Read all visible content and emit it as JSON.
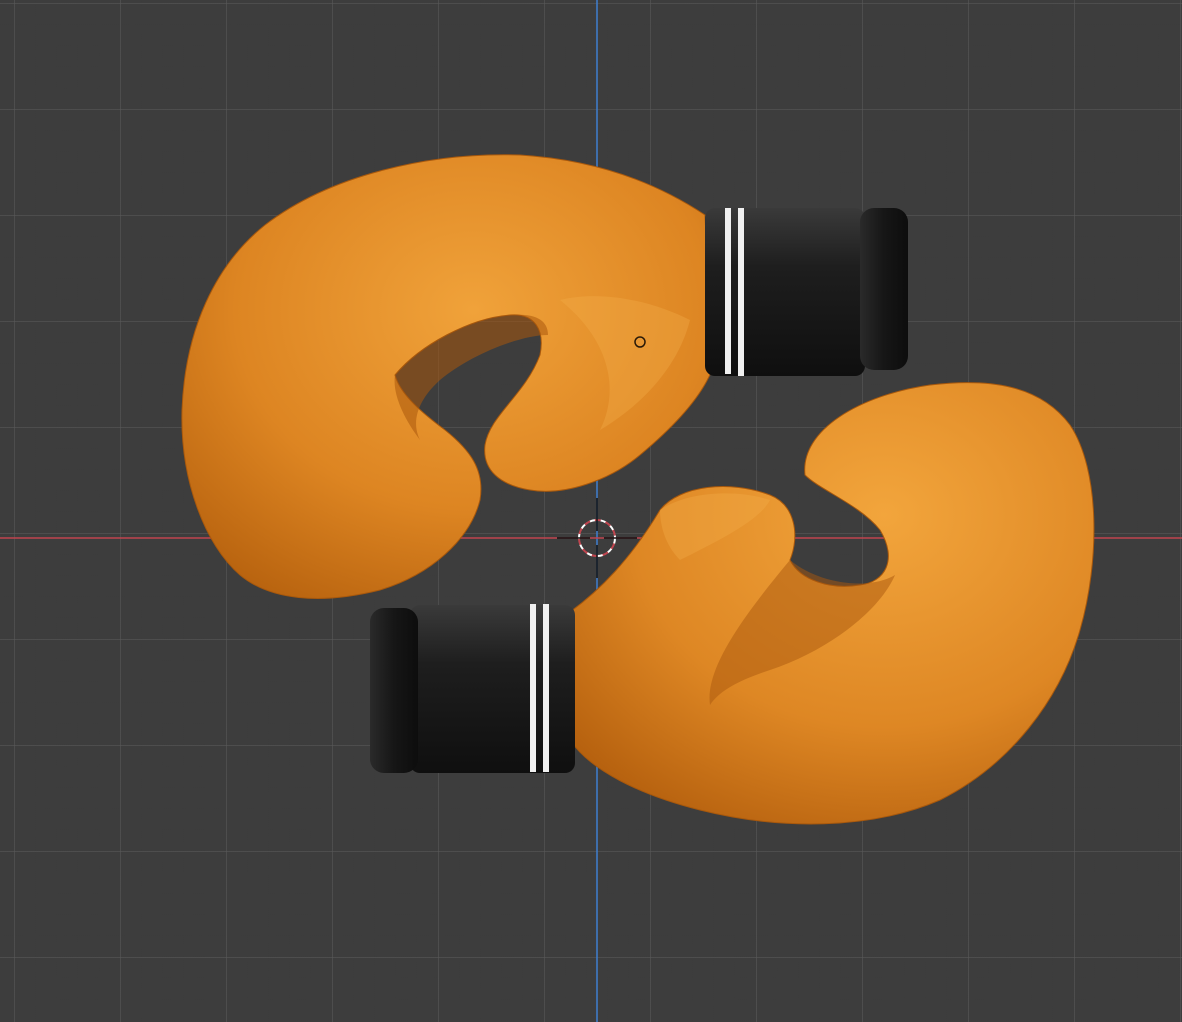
{
  "viewport": {
    "background": "#3d3d3d",
    "grid_color": "#5a5a5a",
    "x_axis_color": "#c0454f",
    "y_axis_color": "#3f7fd0"
  },
  "scene": {
    "object": "boxing-gloves",
    "glove_color": "#e08a26",
    "cuff_color": "#1a1a1a",
    "stripe_color": "#f0f0f0"
  },
  "overlays": {
    "cursor": "3d-cursor-icon",
    "origin": "origin-point-icon"
  }
}
